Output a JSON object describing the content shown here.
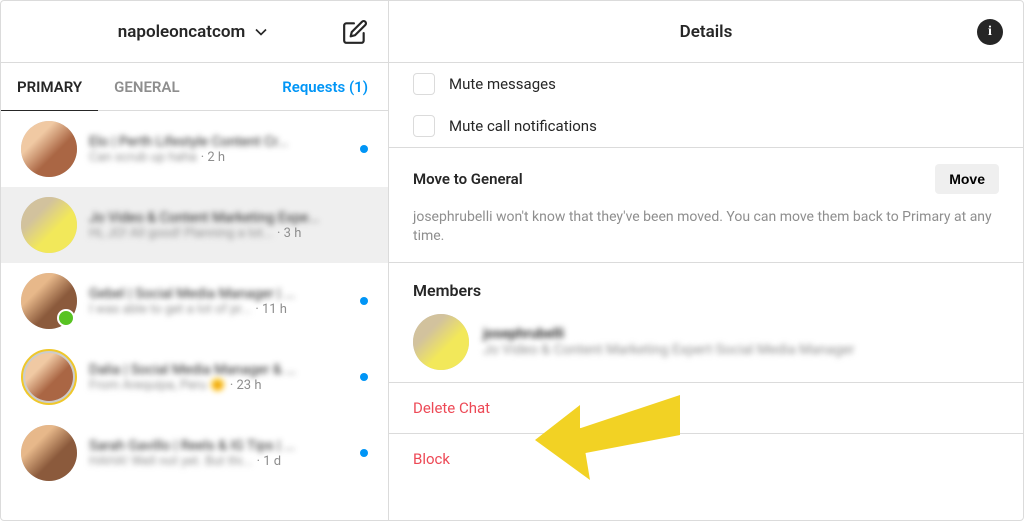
{
  "left_header": {
    "username": "napoleoncatcom"
  },
  "tabs": {
    "primary": "PRIMARY",
    "general": "GENERAL",
    "requests": "Requests (1)"
  },
  "conversations": [
    {
      "name": "Elo | Perth Lifestyle Content Cr...",
      "preview": "Can scrub up haha",
      "time": "· 2 h",
      "unread": true
    },
    {
      "name": "Jo Video & Content Marketing Expe...",
      "preview": "Hi, JO! All good! Planning a lot...",
      "time": "· 3 h",
      "unread": false,
      "selected": true
    },
    {
      "name": "Gebel | Social Media Manager | ...",
      "preview": "I was able to get a lot of pr...",
      "time": "· 11 h",
      "unread": true
    },
    {
      "name": "Dalia | Social Media Manager & ...",
      "preview": "From Arequipa, Peru 🌞",
      "time": "· 23 h",
      "unread": true
    },
    {
      "name": "Sarah Gavillo | Reels & IG Tips | ...",
      "preview": "HAHA! Well not yet. But thi...",
      "time": "· 1 d",
      "unread": true
    }
  ],
  "right_header": {
    "title": "Details"
  },
  "mute": {
    "messages": "Mute messages",
    "calls": "Mute call notifications"
  },
  "move": {
    "title": "Move to General",
    "button": "Move",
    "description": "josephrubelli won't know that they've been moved. You can move them back to Primary at any time."
  },
  "members": {
    "title": "Members",
    "items": [
      {
        "username": "josephrubelli",
        "fullname": "Jo Video & Content Marketing Expert·Social Media Manager"
      }
    ]
  },
  "actions": {
    "delete": "Delete Chat",
    "block": "Block"
  }
}
